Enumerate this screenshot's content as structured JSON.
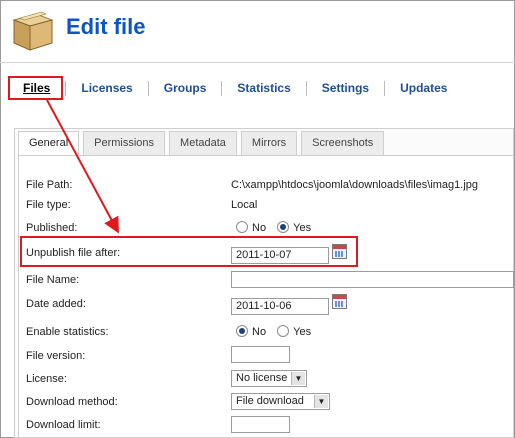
{
  "header": {
    "title": "Edit file",
    "icon": "box-icon"
  },
  "nav": {
    "items": [
      {
        "label": "Files",
        "active": true
      },
      {
        "label": "Licenses"
      },
      {
        "label": "Groups"
      },
      {
        "label": "Statistics"
      },
      {
        "label": "Settings"
      },
      {
        "label": "Updates"
      }
    ]
  },
  "tabs": [
    {
      "label": "General",
      "active": true
    },
    {
      "label": "Permissions"
    },
    {
      "label": "Metadata"
    },
    {
      "label": "Mirrors"
    },
    {
      "label": "Screenshots"
    }
  ],
  "form": {
    "file_path": {
      "label": "File Path:",
      "value": "C:\\xampp\\htdocs\\joomla\\downloads\\files\\imag1.jpg"
    },
    "file_type": {
      "label": "File type:",
      "value": "Local"
    },
    "published": {
      "label": "Published:",
      "opt_no": "No",
      "opt_yes": "Yes",
      "selected": "Yes"
    },
    "unpublish": {
      "label": "Unpublish file after:",
      "value": "2011-10-07"
    },
    "file_name": {
      "label": "File Name:",
      "value": ""
    },
    "date_added": {
      "label": "Date added:",
      "value": "2011-10-06"
    },
    "enable_stats": {
      "label": "Enable statistics:",
      "opt_no": "No",
      "opt_yes": "Yes",
      "selected": "No"
    },
    "file_version": {
      "label": "File version:",
      "value": ""
    },
    "license": {
      "label": "License:",
      "value": "No license"
    },
    "download_method": {
      "label": "Download method:",
      "value": "File download"
    },
    "download_limit": {
      "label": "Download limit:",
      "value": ""
    }
  },
  "colors": {
    "title": "#0b55c4",
    "nav_link": "#1e4f94",
    "highlight": "#e0191f"
  }
}
